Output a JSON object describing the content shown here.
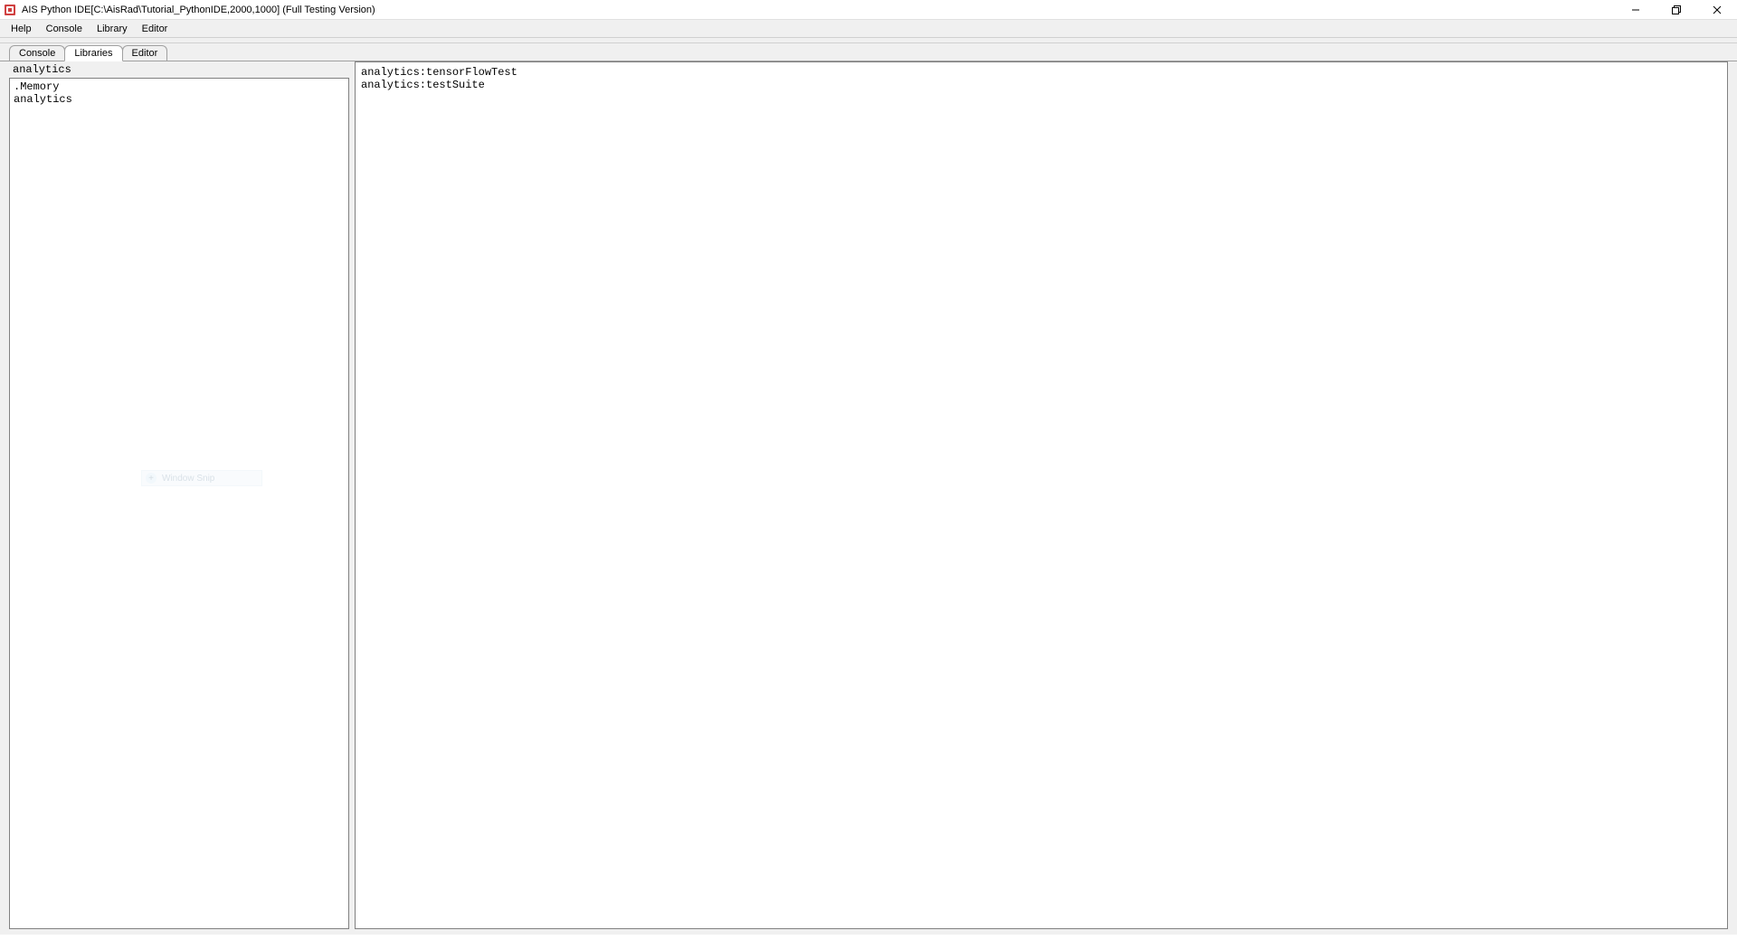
{
  "window": {
    "title": "AIS Python IDE[C:\\AisRad\\Tutorial_PythonIDE,2000,1000] (Full Testing Version)"
  },
  "menubar": {
    "items": [
      "Help",
      "Console",
      "Library",
      "Editor"
    ]
  },
  "tabs": {
    "items": [
      "Console",
      "Libraries",
      "Editor"
    ],
    "active_index": 1
  },
  "left_panel": {
    "filter_value": "analytics",
    "items": [
      ".Memory",
      "analytics"
    ]
  },
  "right_panel": {
    "lines": [
      "analytics:tensorFlowTest",
      "analytics:testSuite"
    ]
  },
  "overlay": {
    "label": "Window Snip"
  }
}
